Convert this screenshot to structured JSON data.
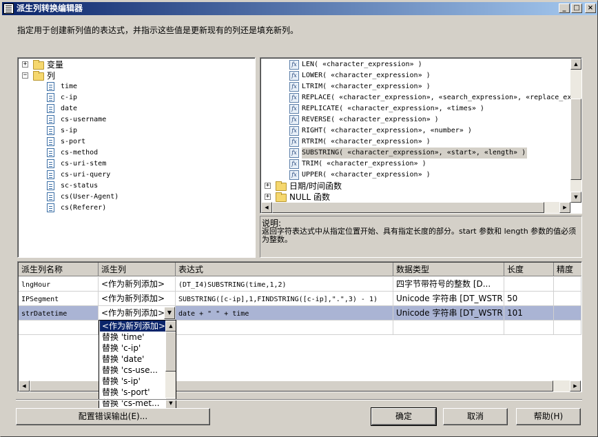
{
  "window": {
    "title": "派生列转换编辑器",
    "minimize": "_",
    "maximize": "□",
    "close": "×"
  },
  "description": "指定用于创建新列值的表达式，并指示这些值是更新现有的列还是填充新列。",
  "left_tree": {
    "variables": {
      "expander": "+",
      "label": "变量"
    },
    "columns": {
      "expander": "−",
      "label": "列"
    },
    "items": [
      "time",
      "c-ip",
      "date",
      "cs-username",
      "s-ip",
      "s-port",
      "cs-method",
      "cs-uri-stem",
      "cs-uri-query",
      "sc-status",
      "cs(User-Agent)",
      "cs(Referer)"
    ]
  },
  "right_tree": {
    "functions": [
      "LEN( «character_expression» )",
      "LOWER( «character_expression» )",
      "LTRIM( «character_expression» )",
      "REPLACE( «character_expression», «search_expression», «replace_ex",
      "REPLICATE( «character_expression», «times» )",
      "REVERSE( «character_expression» )",
      "RIGHT( «character_expression», «number» )",
      "RTRIM( «character_expression» )",
      "SUBSTRING( «character_expression», «start», «length» )",
      "TRIM( «character_expression» )",
      "UPPER( «character_expression» )"
    ],
    "selected_index": 8,
    "fx_label": "fx",
    "folders": [
      {
        "expander": "+",
        "label": "日期/时间函数"
      },
      {
        "expander": "+",
        "label": "NULL 函数"
      }
    ]
  },
  "help": {
    "title": "说明:",
    "text": "返回字符表达式中从指定位置开始、具有指定长度的部分。start 参数和 length 参数的值必须为整数。"
  },
  "grid": {
    "headers": [
      "派生列名称",
      "派生列",
      "表达式",
      "数据类型",
      "长度",
      "精度"
    ],
    "rows": [
      {
        "name": "lngHour",
        "derived": "<作为新列添加>",
        "expression": "(DT_I4)SUBSTRING(time,1,2)",
        "type": "四字节带符号的整数 [D...",
        "length": ""
      },
      {
        "name": "IPSegment",
        "derived": "<作为新列添加>",
        "expression": "SUBSTRING([c-ip],1,FINDSTRING([c-ip],\".\",3) - 1)",
        "type": "Unicode 字符串 [DT_WSTR]",
        "length": "50"
      },
      {
        "name": "strDatetime",
        "derived": "<作为新列添加>",
        "expression": "date + \" \" + time",
        "type": "Unicode 字符串 [DT_WSTR]",
        "length": "101"
      }
    ],
    "selected_row": 2
  },
  "dropdown": {
    "options": [
      "<作为新列添加>",
      "替换 'time'",
      "替换 'c-ip'",
      "替换 'date'",
      "替换 'cs-use...",
      "替换 's-ip'",
      "替换 's-port'",
      "替换 'cs-met..."
    ],
    "selected_index": 0
  },
  "buttons": {
    "error_output": "配置错误输出(E)...",
    "ok": "确定",
    "cancel": "取消",
    "help": "帮助(H)"
  }
}
